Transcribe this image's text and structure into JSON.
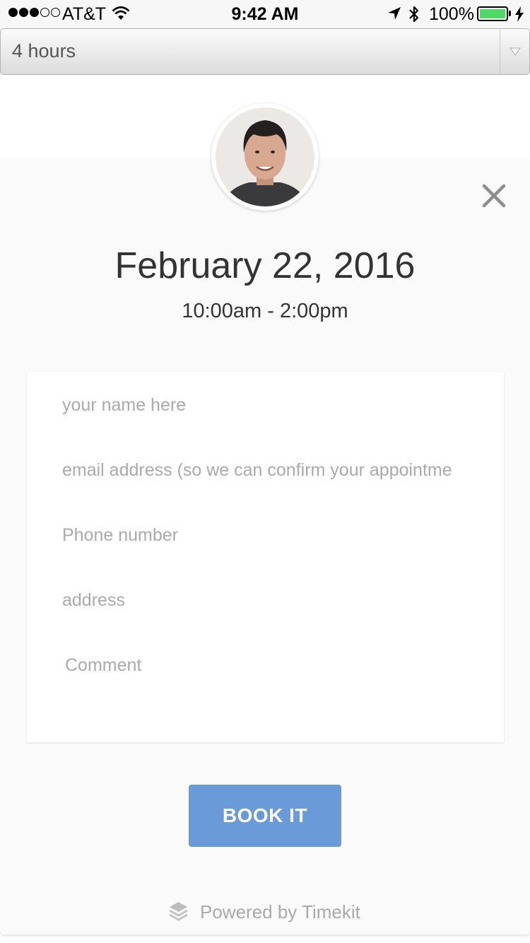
{
  "status_bar": {
    "carrier": "AT&T",
    "time": "9:42 AM",
    "battery_percent": "100%",
    "battery_level": 1.0
  },
  "duration_select": {
    "value": "4 hours"
  },
  "booking": {
    "date": "February 22, 2016",
    "time_range": "10:00am - 2:00pm"
  },
  "form": {
    "name_placeholder": "your name here",
    "email_placeholder": "email address (so we can confirm your appointme",
    "phone_placeholder": "Phone number",
    "address_placeholder": "address",
    "comment_placeholder": "Comment"
  },
  "book_button_label": "BOOK IT",
  "footer": {
    "powered_by": "Powered by Timekit"
  },
  "colors": {
    "accent": "#6a9ad8",
    "battery": "#4cd964",
    "placeholder": "#aaaaaa"
  }
}
